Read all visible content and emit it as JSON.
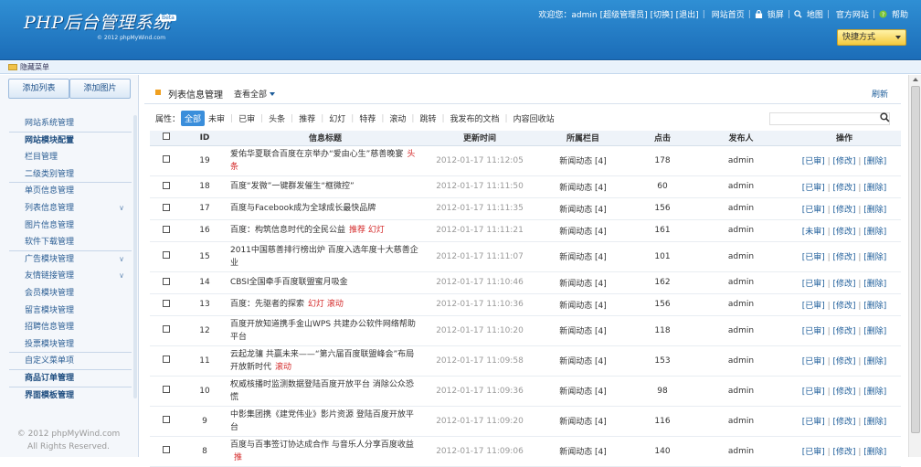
{
  "header": {
    "title": "PHP后台管理系统",
    "beta": "Beta",
    "copyright": "© 2012 phpMyWind.com",
    "welcome": "欢迎您：admin",
    "role_link": "[超级管理员]",
    "switch_link": "[切换]",
    "logout_link": "[退出]",
    "nav_home": "网站首页",
    "nav_lock": "锁屏",
    "nav_map": "地图",
    "nav_official": "官方网站",
    "nav_help": "帮助",
    "shortcut": "快捷方式"
  },
  "subbar": {
    "hide_menu": "隐藏菜单"
  },
  "sidebar": {
    "add_list": "添加列表",
    "add_image": "添加图片",
    "menu": [
      {
        "label": "网站系统管理",
        "bold": false,
        "sep": true,
        "chev": ""
      },
      {
        "label": "网站模块配置",
        "bold": true,
        "sep": false,
        "chev": ""
      },
      {
        "label": "栏目管理",
        "bold": false,
        "sep": false,
        "chev": ""
      },
      {
        "label": "二级类别管理",
        "bold": false,
        "sep": true,
        "chev": ""
      },
      {
        "label": "单页信息管理",
        "bold": false,
        "sep": false,
        "chev": ""
      },
      {
        "label": "列表信息管理",
        "bold": false,
        "sep": false,
        "chev": "∨"
      },
      {
        "label": "图片信息管理",
        "bold": false,
        "sep": false,
        "chev": ""
      },
      {
        "label": "软件下载管理",
        "bold": false,
        "sep": true,
        "chev": ""
      },
      {
        "label": "广告模块管理",
        "bold": false,
        "sep": false,
        "chev": "∨"
      },
      {
        "label": "友情链接管理",
        "bold": false,
        "sep": false,
        "chev": "∨"
      },
      {
        "label": "会员模块管理",
        "bold": false,
        "sep": false,
        "chev": ""
      },
      {
        "label": "留言模块管理",
        "bold": false,
        "sep": false,
        "chev": ""
      },
      {
        "label": "招聘信息管理",
        "bold": false,
        "sep": false,
        "chev": ""
      },
      {
        "label": "投票模块管理",
        "bold": false,
        "sep": true,
        "chev": ""
      },
      {
        "label": "自定义菜单项",
        "bold": false,
        "sep": true,
        "chev": ""
      },
      {
        "label": "商品订单管理",
        "bold": true,
        "sep": true,
        "chev": ""
      },
      {
        "label": "界面模板管理",
        "bold": true,
        "sep": false,
        "chev": ""
      }
    ],
    "copy1": "© 2012 phpMyWind.com",
    "copy2": "All Rights Reserved."
  },
  "main": {
    "title": "列表信息管理",
    "view_all": "查看全部",
    "refresh": "刷新",
    "attr_label": "属性：",
    "filters": [
      "全部",
      "未审",
      "已审",
      "头条",
      "推荐",
      "幻灯",
      "特荐",
      "滚动",
      "跳转",
      "我发布的文档",
      "内容回收站"
    ],
    "columns": [
      "ID",
      "信息标题",
      "更新时间",
      "所属栏目",
      "点击",
      "发布人",
      "操作"
    ],
    "rows": [
      {
        "id": "19",
        "title": "爱佑华夏联合百度在京举办“爱由心生”慈善晚宴",
        "flag": "头条",
        "time": "2012-01-17 11:12:05",
        "cat": "新闻动态 [4]",
        "hits": "178",
        "author": "admin",
        "status": "[已审]",
        "edit": "[修改]",
        "del": "[删除]"
      },
      {
        "id": "18",
        "title": "百度“发微”一键群发催生“框微控”",
        "flag": "",
        "time": "2012-01-17 11:11:50",
        "cat": "新闻动态 [4]",
        "hits": "60",
        "author": "admin",
        "status": "[已审]",
        "edit": "[修改]",
        "del": "[删除]"
      },
      {
        "id": "17",
        "title": "百度与Facebook成为全球成长最快品牌",
        "flag": "",
        "time": "2012-01-17 11:11:35",
        "cat": "新闻动态 [4]",
        "hits": "156",
        "author": "admin",
        "status": "[已审]",
        "edit": "[修改]",
        "del": "[删除]"
      },
      {
        "id": "16",
        "title": "百度：构筑信息时代的全民公益",
        "flag": "推荐 幻灯",
        "time": "2012-01-17 11:11:21",
        "cat": "新闻动态 [4]",
        "hits": "161",
        "author": "admin",
        "status": "[未审]",
        "edit": "[修改]",
        "del": "[删除]"
      },
      {
        "id": "15",
        "title": "2011中国慈善排行榜出炉 百度入选年度十大慈善企业",
        "flag": "",
        "time": "2012-01-17 11:11:07",
        "cat": "新闻动态 [4]",
        "hits": "101",
        "author": "admin",
        "status": "[已审]",
        "edit": "[修改]",
        "del": "[删除]"
      },
      {
        "id": "14",
        "title": "CBSI全国牵手百度联盟蜜月吸金",
        "flag": "",
        "time": "2012-01-17 11:10:46",
        "cat": "新闻动态 [4]",
        "hits": "162",
        "author": "admin",
        "status": "[已审]",
        "edit": "[修改]",
        "del": "[删除]"
      },
      {
        "id": "13",
        "title": "百度：先驱者的探索",
        "flag": "幻灯 滚动",
        "time": "2012-01-17 11:10:36",
        "cat": "新闻动态 [4]",
        "hits": "156",
        "author": "admin",
        "status": "[已审]",
        "edit": "[修改]",
        "del": "[删除]"
      },
      {
        "id": "12",
        "title": "百度开放知道携手金山WPS 共建办公软件网络帮助平台",
        "flag": "",
        "time": "2012-01-17 11:10:20",
        "cat": "新闻动态 [4]",
        "hits": "118",
        "author": "admin",
        "status": "[已审]",
        "edit": "[修改]",
        "del": "[删除]"
      },
      {
        "id": "11",
        "title": "云起龙骧 共赢未来——“第六届百度联盟峰会”布局开放新时代",
        "flag": "滚动",
        "time": "2012-01-17 11:09:58",
        "cat": "新闻动态 [4]",
        "hits": "153",
        "author": "admin",
        "status": "[已审]",
        "edit": "[修改]",
        "del": "[删除]"
      },
      {
        "id": "10",
        "title": "权威核播时监测数据登陆百度开放平台 消除公众恐慌",
        "flag": "",
        "time": "2012-01-17 11:09:36",
        "cat": "新闻动态 [4]",
        "hits": "98",
        "author": "admin",
        "status": "[已审]",
        "edit": "[修改]",
        "del": "[删除]"
      },
      {
        "id": "9",
        "title": "中影集团携《建党伟业》影片资源 登陆百度开放平台",
        "flag": "",
        "time": "2012-01-17 11:09:20",
        "cat": "新闻动态 [4]",
        "hits": "116",
        "author": "admin",
        "status": "[已审]",
        "edit": "[修改]",
        "del": "[删除]"
      },
      {
        "id": "8",
        "title": "百度与百事签订协达成合作 与音乐人分享百度收益",
        "flag": "推",
        "time": "2012-01-17 11:09:06",
        "cat": "新闻动态 [4]",
        "hits": "140",
        "author": "admin",
        "status": "[已审]",
        "edit": "[修改]",
        "del": "[删除]"
      }
    ]
  }
}
